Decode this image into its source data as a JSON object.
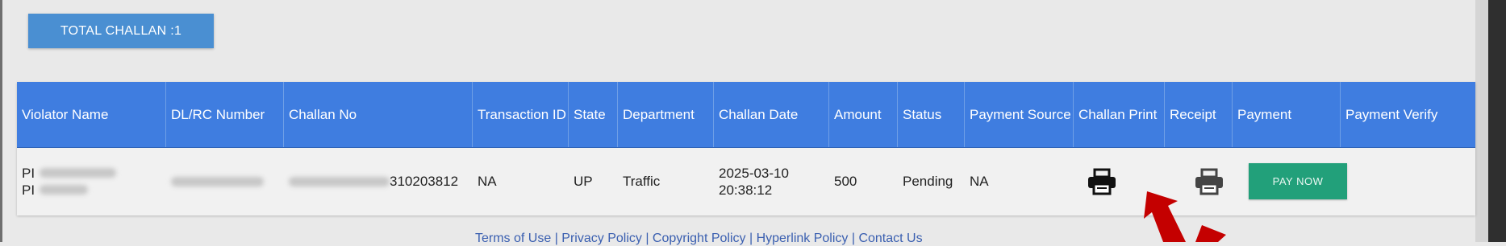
{
  "summary": {
    "total_label": "TOTAL CHALLAN :1"
  },
  "table": {
    "headers": [
      "Violator Name",
      "DL/RC Number",
      "Challan No",
      "Transaction ID",
      "State",
      "Department",
      "Challan Date",
      "Amount",
      "Status",
      "Payment Source",
      "Challan Print",
      "Receipt",
      "Payment",
      "Payment Verify"
    ],
    "row": {
      "violator_name_line1": "PI",
      "violator_name_line2": "PI",
      "challan_no_suffix": "310203812",
      "transaction_id": "NA",
      "state": "UP",
      "department": "Traffic",
      "challan_date_line1": "2025-03-10",
      "challan_date_line2": "20:38:12",
      "amount": "500",
      "status": "Pending",
      "payment_source": "NA",
      "pay_button": "PAY NOW",
      "challan_print_icon": "printer-icon",
      "receipt_icon": "printer-icon"
    }
  },
  "footer": {
    "links": [
      "Terms of Use",
      "Privacy Policy",
      "Copyright Policy",
      "Hyperlink Policy",
      "Contact Us"
    ],
    "separator": " | "
  },
  "colors": {
    "header_bg": "#3f7de0",
    "button_blue": "#4a8fd2",
    "pay_green": "#22a07a",
    "arrow_red": "#c40000"
  }
}
